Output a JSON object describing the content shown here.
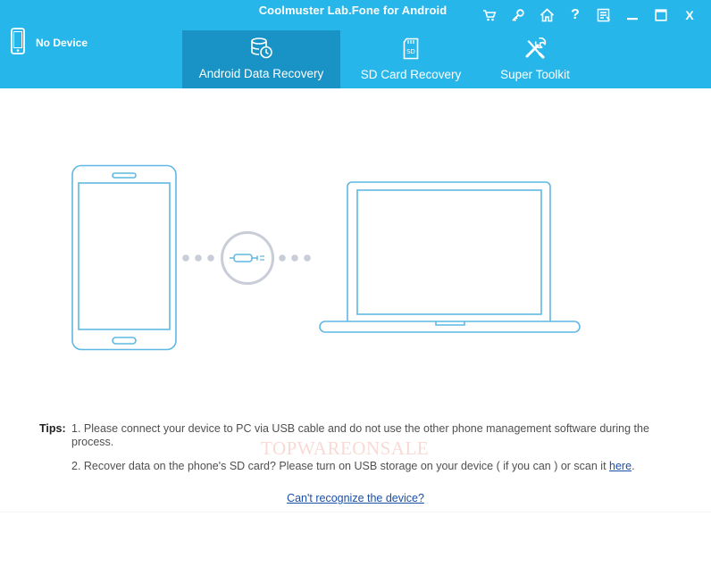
{
  "window": {
    "title": "Coolmuster Lab.Fone for Android",
    "controls": [
      "cart-icon",
      "key-icon",
      "home-icon",
      "help-icon",
      "feedback-icon",
      "minimize-icon",
      "maximize-icon",
      "close-icon"
    ],
    "help_glyph": "?",
    "close_glyph": "X"
  },
  "device": {
    "status": "No Device",
    "icon": "phone-icon"
  },
  "tabs": [
    {
      "label": "Android Data Recovery",
      "icon": "database-clock-icon",
      "active": true
    },
    {
      "label": "SD Card Recovery",
      "icon": "sd-card-icon",
      "active": false
    },
    {
      "label": "Super Toolkit",
      "icon": "tools-icon",
      "active": false
    }
  ],
  "tips": {
    "label": "Tips:",
    "tip1": "1. Please connect your device to PC via USB cable and do not use the other phone management software during the process.",
    "tip2_text": "2. Recover data on the phone's SD card? Please turn on USB storage on your device ( if you can ) or scan it ",
    "tip2_link": "here",
    "tip2_end": "."
  },
  "help_link": "Can't recognize the device?",
  "watermark": "TOPWAREONSALE",
  "colors": {
    "header": "#27b6e9",
    "active_tab": "#1993c5",
    "illustration": "#5fb8e3",
    "connector": "#c9cdd8"
  }
}
